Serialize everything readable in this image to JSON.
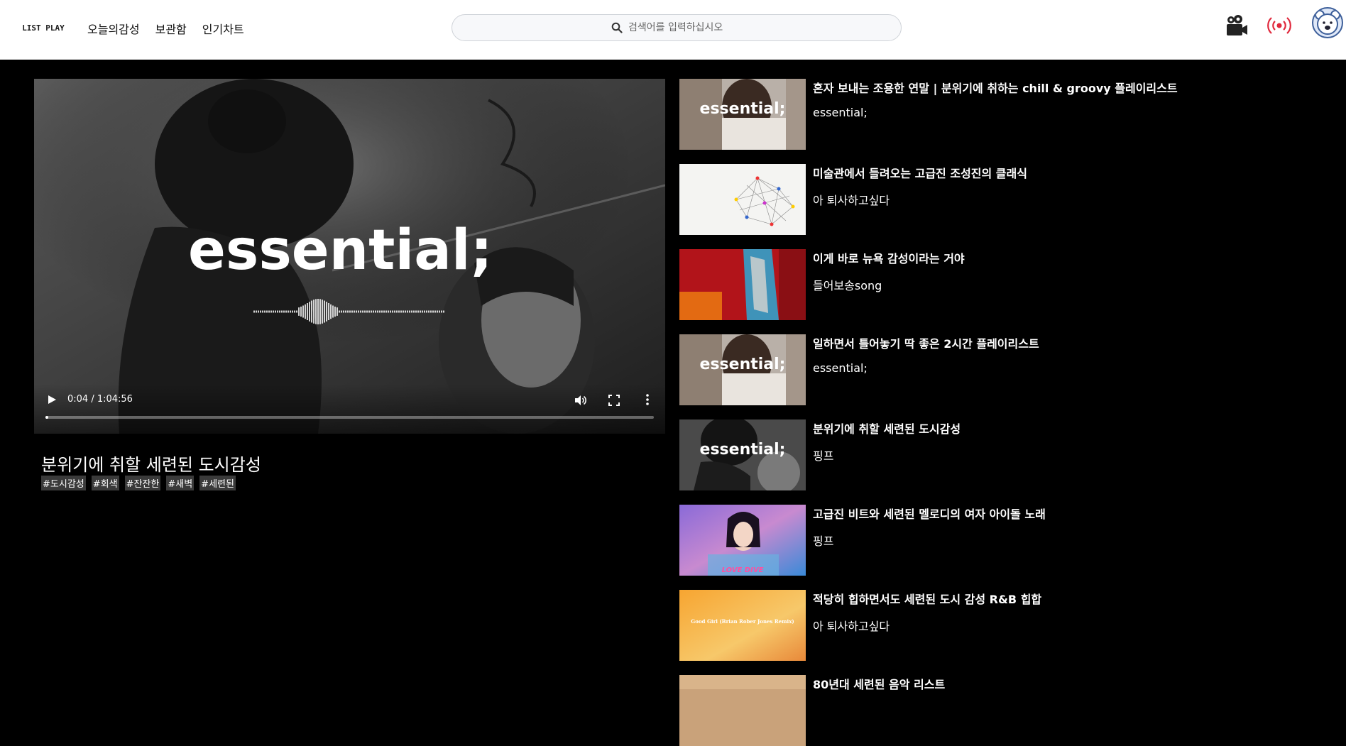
{
  "header": {
    "logo_text": "LIST PLAY",
    "nav": [
      "오늘의감성",
      "보관함",
      "인기차트"
    ],
    "search_placeholder": "검색어를 입력하십시오"
  },
  "player": {
    "overlay_text": "essential;",
    "time": "0:04 / 1:04:56",
    "progress": 0.001,
    "title": "분위기에 취할 세련된 도시감성",
    "tags": [
      "#도시감성",
      "#회색",
      "#잔잔한",
      "#새벽",
      "#세련된"
    ]
  },
  "playlist": [
    {
      "title": "혼자 보내는 조용한 연말 | 분위기에 취하는 chill & groovy 플레이리스트",
      "channel": "essential;",
      "thumb_text": "essential;",
      "thumb": "essential-color"
    },
    {
      "title": "미술관에서 들려오는 고급진 조성진의 클래식",
      "channel": "아 퇴사하고싶다",
      "thumb_text": "",
      "thumb": "network"
    },
    {
      "title": "이게 바로 뉴욕 감성이라는 거야",
      "channel": "들어보송song",
      "thumb_text": "",
      "thumb": "red-abstract"
    },
    {
      "title": "일하면서 틀어놓기 딱 좋은 2시간 플레이리스트",
      "channel": "essential;",
      "thumb_text": "essential;",
      "thumb": "essential-color"
    },
    {
      "title": "분위기에 취할 세련된 도시감성",
      "channel": "핑프",
      "thumb_text": "essential;",
      "thumb": "essential-bw"
    },
    {
      "title": "고급진 비트와 세련된 멜로디의 여자 아이돌 노래",
      "channel": "핑프",
      "thumb_text": "LOVE DIVE",
      "thumb": "idol"
    },
    {
      "title": "적당히 힙하면서도 세련된 도시 감성 R&B 힙합",
      "channel": "아 퇴사하고싶다",
      "thumb_text": "Good Girl (Brian Rober Jones Remix)",
      "thumb": "orange"
    },
    {
      "title": "80년대 세련된 음악 리스트",
      "channel": "",
      "thumb_text": "",
      "thumb": "sunset"
    }
  ],
  "colors": {
    "accent_live": "#e0283c",
    "avatar_border": "#3d5f9a"
  }
}
